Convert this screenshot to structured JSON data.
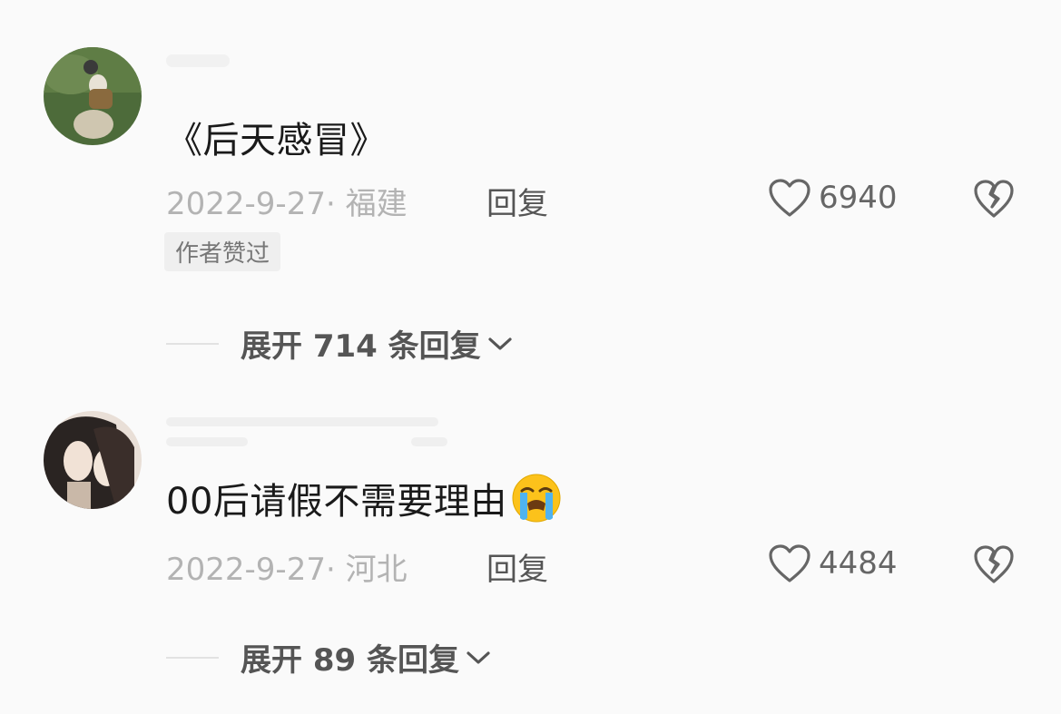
{
  "comments": [
    {
      "content": "《后天感冒》",
      "date_location": "2022-9-27· 福建",
      "reply_label": "回复",
      "likes": "6940",
      "badge": "作者赞过",
      "expand_label": "展开 714 条回复"
    },
    {
      "content": "00后请假不需要理由",
      "emoji": "loudly-crying-face-icon",
      "date_location": "2022-9-27· 河北",
      "reply_label": "回复",
      "likes": "4484",
      "expand_label": "展开 89 条回复"
    }
  ],
  "colors": {
    "background": "#fafafa",
    "text_primary": "#1a1a1a",
    "text_secondary": "#b3b3b3",
    "action": "#555555"
  }
}
